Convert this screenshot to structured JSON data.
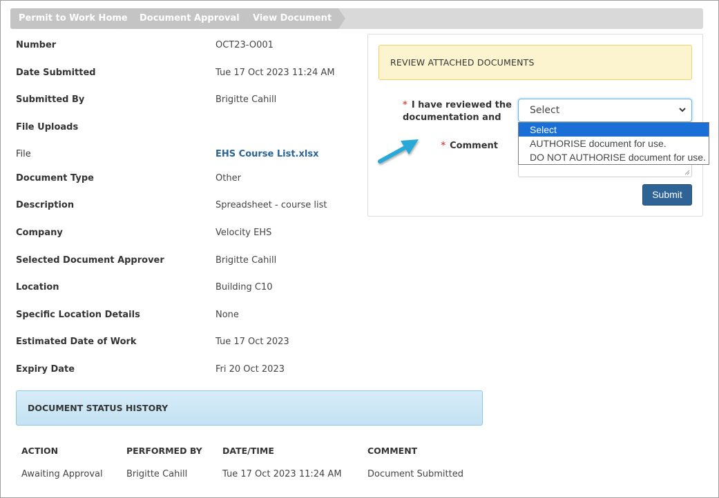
{
  "breadcrumb": [
    "Permit to Work Home",
    "Document Approval",
    "View Document"
  ],
  "details": [
    {
      "label": "Number",
      "value": "OCT23-O001"
    },
    {
      "label": "Date Submitted",
      "value": "Tue 17 Oct 2023 11:24 AM"
    },
    {
      "label": "Submitted By",
      "value": "Brigitte Cahill"
    },
    {
      "label": "File Uploads",
      "value": ""
    },
    {
      "label": "File",
      "value": "EHS Course List.xlsx"
    },
    {
      "label": "Document Type",
      "value": "Other"
    },
    {
      "label": "Description",
      "value": "Spreadsheet - course list"
    },
    {
      "label": "Company",
      "value": "Velocity EHS"
    },
    {
      "label": "Selected Document Approver",
      "value": "Brigitte Cahill"
    },
    {
      "label": "Location",
      "value": "Building C10"
    },
    {
      "label": "Specific Location Details",
      "value": "None"
    },
    {
      "label": "Estimated Date of Work",
      "value": "Tue 17 Oct 2023"
    },
    {
      "label": "Expiry Date",
      "value": "Fri 20 Oct 2023"
    }
  ],
  "review": {
    "header": "REVIEW ATTACHED DOCUMENTS",
    "reviewed_label_line1": "I have reviewed the",
    "reviewed_label_line2": "documentation and",
    "select_value": "Select",
    "options": [
      "Select",
      "AUTHORISE document for use.",
      "DO NOT AUTHORISE document for use."
    ],
    "comment_label": "Comment",
    "required_mark": "*",
    "submit_label": "Submit"
  },
  "history": {
    "header": "DOCUMENT STATUS HISTORY",
    "columns": [
      "ACTION",
      "PERFORMED BY",
      "DATE/TIME",
      "COMMENT"
    ],
    "rows": [
      [
        "Awaiting Approval",
        "Brigitte Cahill",
        "Tue 17 Oct 2023 11:24 AM",
        "Document Submitted"
      ]
    ]
  },
  "colors": {
    "accent": "#2e6396",
    "highlight": "#1a6fd6",
    "review_header_bg": "#fcf3cf",
    "history_header_bg": "#c9e5f4",
    "arrow": "#29a9d8"
  }
}
